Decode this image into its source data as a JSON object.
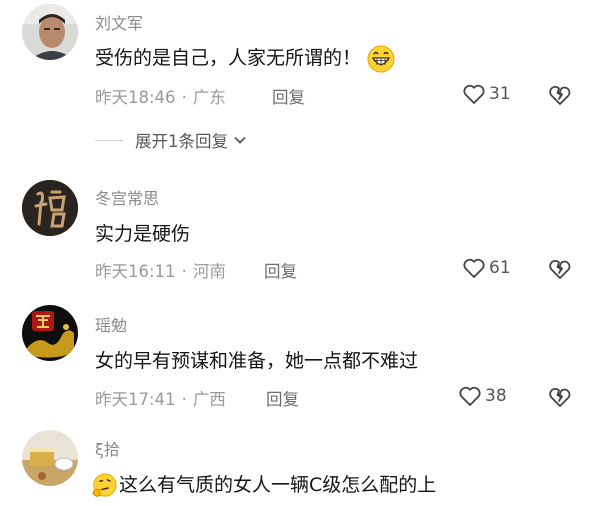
{
  "comments": [
    {
      "username": "刘文军",
      "text": "受伤的是自己，人家无所谓的！",
      "time": "昨天18:46",
      "location": "广东",
      "reply_label": "回复",
      "likes": "31"
    },
    {
      "username": "冬宫常思",
      "text": "实力是硬伤",
      "time": "昨天16:11",
      "location": "河南",
      "reply_label": "回复",
      "likes": "61"
    },
    {
      "username": "瑶勉",
      "text": "女的早有预谋和准备，她一点都不难过",
      "time": "昨天17:41",
      "location": "广西",
      "reply_label": "回复",
      "likes": "38"
    },
    {
      "username": "ξ拾",
      "text": "这么有气质的女人一辆C级怎么配的上"
    }
  ],
  "expand_replies": "展开1条回复",
  "separator": "·",
  "colors": {
    "text": "#161616",
    "meta": "#9a9a9a",
    "username": "#8a8a8a"
  },
  "icons": [
    "heart-icon",
    "broken-heart-icon",
    "chevron-down-icon",
    "grin-emoji-icon",
    "thinking-emoji-icon"
  ]
}
